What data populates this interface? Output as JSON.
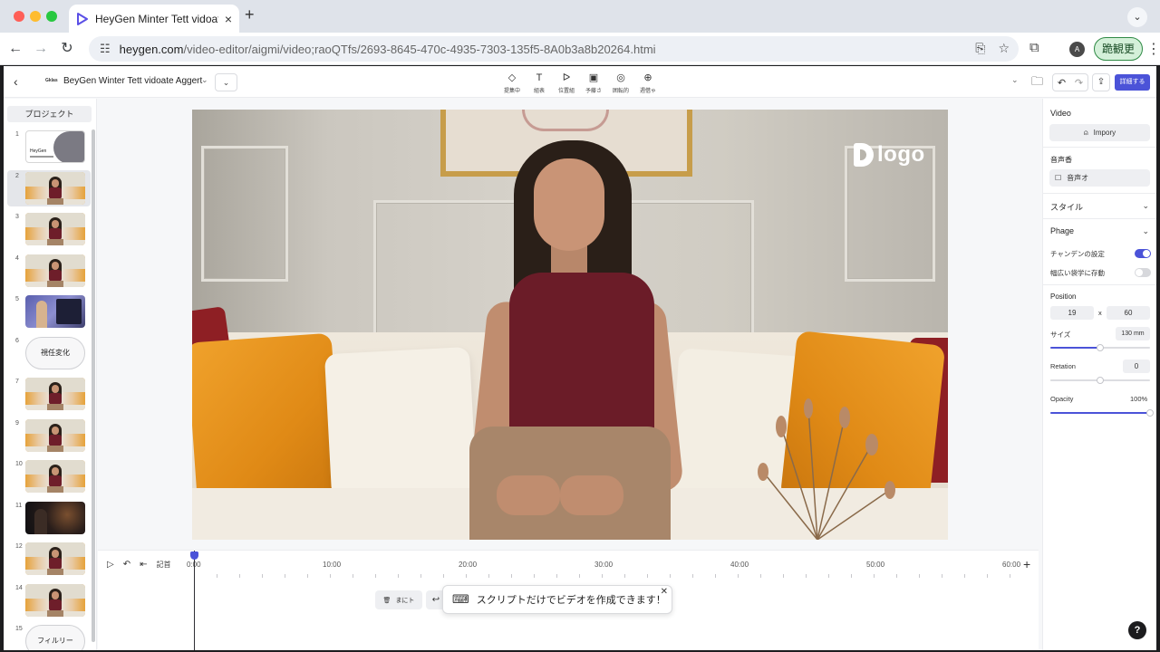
{
  "browser": {
    "tab_title": "HeyGen Minter Tett vidoate A",
    "tab_close": "×",
    "new_tab": "+",
    "url_host": "heygen.com",
    "url_path": "/video-editor/aigmi/video;raoQTfs/2693-8645-470c-4935-7303-135f5-8A0b3a8b20264.htmi",
    "account_label": "跪観更",
    "profile_initial": "A"
  },
  "header": {
    "brand_small": "Gklas",
    "project_title": "BeyGen Winter Tett vidoate Aggert",
    "tools": [
      {
        "icon": "◇",
        "label": "提集中"
      },
      {
        "icon": "T",
        "label": "組表"
      },
      {
        "icon": "ᐅ",
        "label": "位置組"
      },
      {
        "icon": "▣",
        "label": "予藤さ"
      },
      {
        "icon": "◎",
        "label": "囲転的"
      },
      {
        "icon": "⊕",
        "label": "週借ゃ"
      }
    ],
    "export_label": "詳細する"
  },
  "scenes": {
    "header": "プロジェクト",
    "items": [
      {
        "num": "1",
        "kind": "titlecard",
        "text": "HeyGen"
      },
      {
        "num": "2",
        "kind": "photo"
      },
      {
        "num": "3",
        "kind": "photo"
      },
      {
        "num": "4",
        "kind": "photo"
      },
      {
        "num": "5",
        "kind": "screen"
      },
      {
        "num": "6",
        "kind": "textcard",
        "text": "視任変化"
      },
      {
        "num": "7",
        "kind": "photo"
      },
      {
        "num": "9",
        "kind": "photo"
      },
      {
        "num": "10",
        "kind": "photo"
      },
      {
        "num": "11",
        "kind": "dark"
      },
      {
        "num": "12",
        "kind": "photo"
      },
      {
        "num": "14",
        "kind": "photo"
      },
      {
        "num": "15",
        "kind": "textcard",
        "text": "フィルリー"
      }
    ],
    "active_index": 1
  },
  "canvas": {
    "logo_text": "logo"
  },
  "timeline": {
    "label": "記首",
    "ticks": [
      "0:00",
      "10:00",
      "20:00",
      "30:00",
      "40:00",
      "50:00",
      "60:00"
    ],
    "delete_label": "まにト",
    "tooltip_text": "スクリプトだけでビデオを作成できます！"
  },
  "props": {
    "video_title": "Video",
    "import_label": "Impory",
    "audio_title": "音声香",
    "audio_button": "音声オ",
    "style_title": "スタイル",
    "phage_title": "Phage",
    "toggle1_label": "チャンデンの設定",
    "toggle1_on": true,
    "toggle2_label": "幅広い袋学に存動",
    "toggle2_on": false,
    "position_title": "Position",
    "pos_x": "19",
    "pos_sep": "x",
    "pos_y": "60",
    "size_label": "サイズ",
    "size_value": "130 mm",
    "size_level": 0.5,
    "rotation_label": "Retation",
    "rotation_value": "0",
    "rotation_level": 0.5,
    "opacity_label": "Opacity",
    "opacity_value": "100%",
    "opacity_level": 1.0
  },
  "colors": {
    "accent": "#4b53d8",
    "account_bg": "#d4f0d9"
  }
}
